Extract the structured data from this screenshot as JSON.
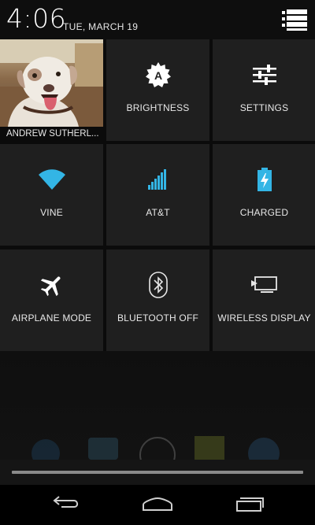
{
  "status": {
    "time": "4:06",
    "date": "TUE, MARCH 19"
  },
  "tiles": {
    "profile": {
      "name": "ANDREW SUTHERL..."
    },
    "brightness": {
      "label": "BRIGHTNESS",
      "icon": "brightness-auto-icon"
    },
    "settings": {
      "label": "SETTINGS",
      "icon": "settings-sliders-icon"
    },
    "wifi": {
      "label": "VINE",
      "icon": "wifi-icon"
    },
    "cellular": {
      "label": "AT&T",
      "icon": "signal-bars-icon"
    },
    "battery": {
      "label": "CHARGED",
      "icon": "battery-charging-icon"
    },
    "airplane": {
      "label": "AIRPLANE MODE",
      "icon": "airplane-icon"
    },
    "bluetooth": {
      "label": "BLUETOOTH OFF",
      "icon": "bluetooth-icon"
    },
    "wireless_display": {
      "label": "WIRELESS DISPLAY",
      "icon": "cast-display-icon"
    }
  },
  "colors": {
    "accent": "#33b5e5",
    "tile_bg": "#1f1f1f",
    "text": "#e8e8e8"
  },
  "navbar": {
    "back_icon": "back-icon",
    "home_icon": "home-icon",
    "recents_icon": "recents-icon"
  }
}
